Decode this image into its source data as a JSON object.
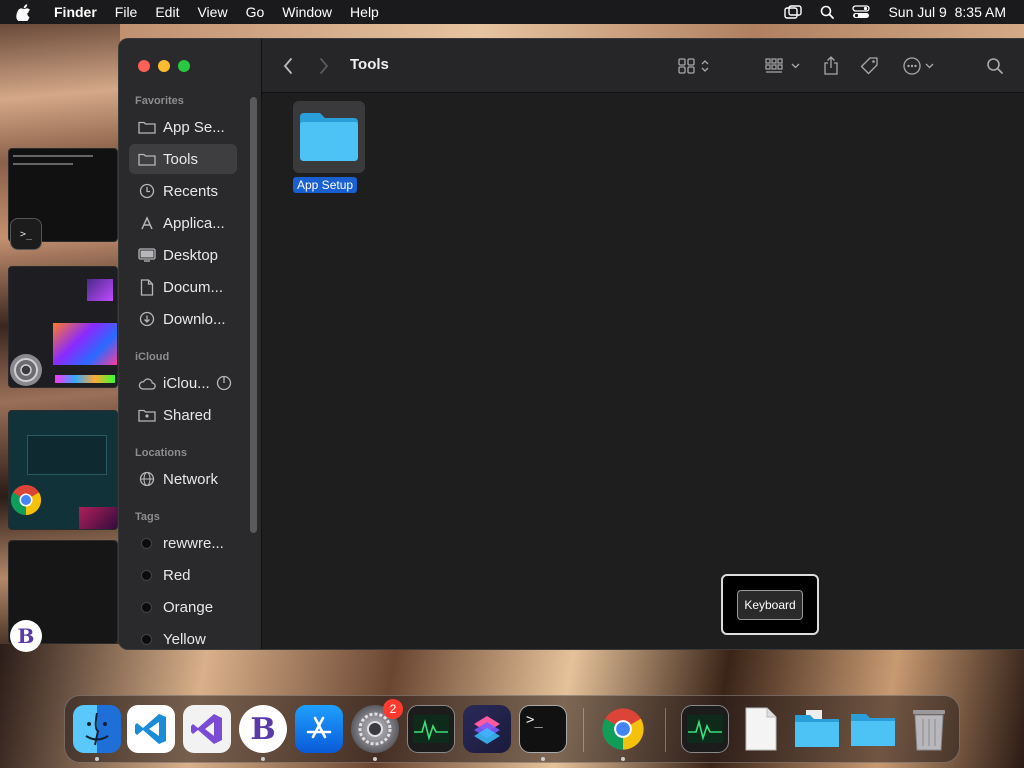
{
  "menubar": {
    "app_name": "Finder",
    "menus": [
      "File",
      "Edit",
      "View",
      "Go",
      "Window",
      "Help"
    ],
    "datetime": "Sun Jul 9  8:35 AM"
  },
  "window": {
    "title": "Tools",
    "sidebar": {
      "favorites_heading": "Favorites",
      "favorites": [
        {
          "label": "App Se...",
          "icon": "folder-icon"
        },
        {
          "label": "Tools",
          "icon": "folder-icon",
          "selected": true
        },
        {
          "label": "Recents",
          "icon": "clock-icon"
        },
        {
          "label": "Applica...",
          "icon": "applications-icon"
        },
        {
          "label": "Desktop",
          "icon": "desktop-icon"
        },
        {
          "label": "Docum...",
          "icon": "document-icon"
        },
        {
          "label": "Downlo...",
          "icon": "download-icon"
        }
      ],
      "icloud_heading": "iCloud",
      "icloud": [
        {
          "label": "iClou...",
          "icon": "cloud-icon"
        },
        {
          "label": "Shared",
          "icon": "shared-folder-icon"
        }
      ],
      "locations_heading": "Locations",
      "locations": [
        {
          "label": "Network",
          "icon": "globe-icon"
        }
      ],
      "tags_heading": "Tags",
      "tags": [
        {
          "label": "rewwre..."
        },
        {
          "label": "Red"
        },
        {
          "label": "Orange"
        },
        {
          "label": "Yellow"
        }
      ]
    },
    "content": {
      "items": [
        {
          "name": "App Setup",
          "kind": "folder",
          "selected": true
        }
      ]
    }
  },
  "keyboard_popup": {
    "label": "Keyboard"
  },
  "dock": {
    "apps": [
      {
        "name": "Finder",
        "icon": "finder-icon",
        "running": true
      },
      {
        "name": "Visual Studio Code",
        "icon": "vscode-icon",
        "running": false
      },
      {
        "name": "Visual Studio",
        "icon": "visual-studio-icon",
        "running": false
      },
      {
        "name": "BBEdit",
        "icon": "bbedit-icon",
        "running": true
      },
      {
        "name": "App Store",
        "icon": "app-store-icon",
        "running": false
      },
      {
        "name": "System Settings",
        "icon": "system-settings-icon",
        "running": true,
        "badge": "2"
      },
      {
        "name": "Activity Monitor",
        "icon": "activity-monitor-icon",
        "running": false
      },
      {
        "name": "Shortcuts",
        "icon": "shortcuts-icon",
        "running": false
      },
      {
        "name": "Terminal",
        "icon": "terminal-icon",
        "running": true
      },
      {
        "name": "Google Chrome",
        "icon": "chrome-icon",
        "running": true
      },
      {
        "name": "Activity Monitor",
        "icon": "activity-monitor-icon",
        "running": false
      },
      {
        "name": "Document",
        "icon": "document-file-icon",
        "running": false
      },
      {
        "name": "Folder Stack",
        "icon": "folder-stack-icon",
        "running": false
      },
      {
        "name": "Folder",
        "icon": "folder-icon",
        "running": false
      },
      {
        "name": "Trash",
        "icon": "trash-icon",
        "running": false
      }
    ]
  },
  "colors": {
    "menubar_bg": "#1a1a1c",
    "finder_bg": "#1e1e1e",
    "sidebar_bg": "#2a2a2c",
    "selection_blue": "#1a5fd0",
    "folder_blue": "#46b8f0",
    "close_red": "#ff5f57",
    "minimize_yellow": "#febc2e",
    "zoom_green": "#28c840"
  }
}
